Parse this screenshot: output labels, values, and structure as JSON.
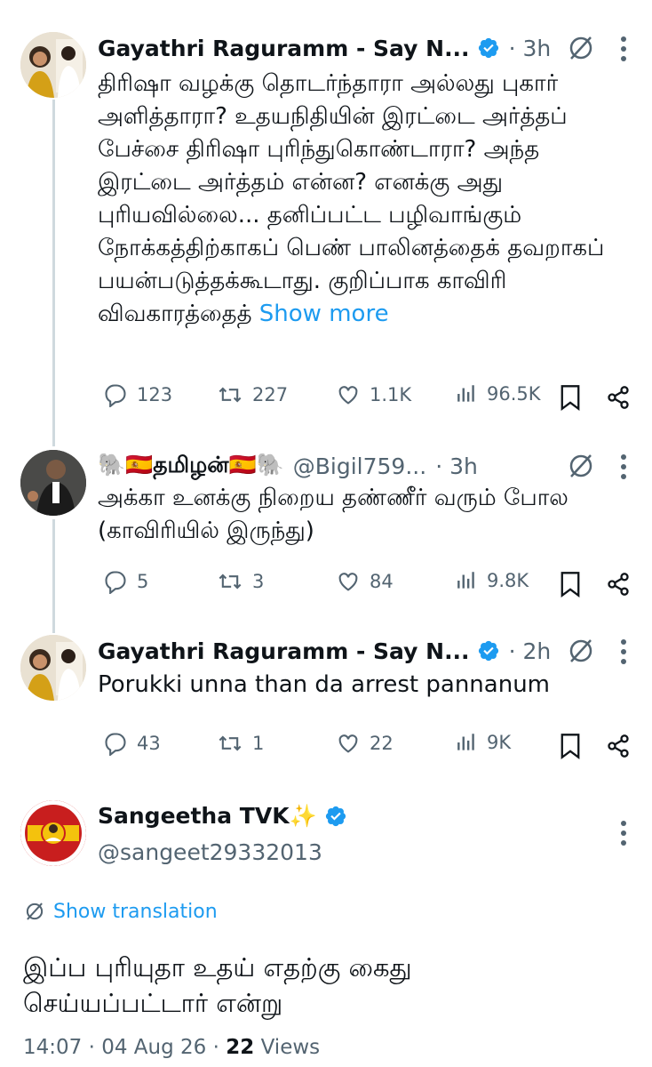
{
  "tweets": [
    {
      "name": "Gayathri Raguramm - Say N...",
      "handle": "",
      "time": "3h",
      "text": "திரிஷா வழக்கு தொடர்ந்தாரா அல்லது புகார் அளித்தாரா? உதயநிதியின் இரட்டை அர்த்தப் பேச்சை திரிஷா புரிந்துகொண்டாரா? அந்த இரட்டை அர்த்தம் என்ன? எனக்கு அது புரியவில்லை... தனிப்பட்ட பழிவாங்கும் நோக்கத்திற்காகப் பெண் பாலினத்தைக் தவறாகப் பயன்படுத்தக்கூடாது. குறிப்பாக காவிரி விவகாரத்தைத்",
      "show_more": "Show more",
      "replies": "123",
      "reposts": "227",
      "likes": "1.1K",
      "views": "96.5K"
    },
    {
      "name": "🐘🇪🇸தமிழன்🇪🇸🐘",
      "handle": "@Bigil759...",
      "time": "3h",
      "text": "அக்கா உனக்கு நிறைய தண்ணீர் வரும் போல (காவிரியில் இருந்து)",
      "replies": "5",
      "reposts": "3",
      "likes": "84",
      "views": "9.8K"
    },
    {
      "name": "Gayathri Raguramm - Say N...",
      "handle": "",
      "time": "2h",
      "text": "Porukki unna than da arrest pannanum",
      "replies": "43",
      "reposts": "1",
      "likes": "22",
      "views": "9K"
    }
  ],
  "main": {
    "name": "Sangeetha TVK✨",
    "handle": "@sangeet29332013",
    "show_translation": "Show translation",
    "text": "இப்ப புரியுதா உதய் எதற்கு கைது செய்யப்பட்டார் என்று",
    "time": "14:07",
    "date": "04 Aug 26",
    "views_count": "22",
    "views_label": "Views"
  },
  "colors": {
    "accent": "#1d9bf0",
    "muted": "#536471",
    "text": "#0f1419",
    "thread_line": "#cfd9de"
  },
  "icons": [
    "reply-icon",
    "repost-icon",
    "like-icon",
    "views-icon",
    "bookmark-icon",
    "share-icon",
    "grok-icon",
    "more-icon",
    "verified-icon",
    "translate-icon"
  ]
}
